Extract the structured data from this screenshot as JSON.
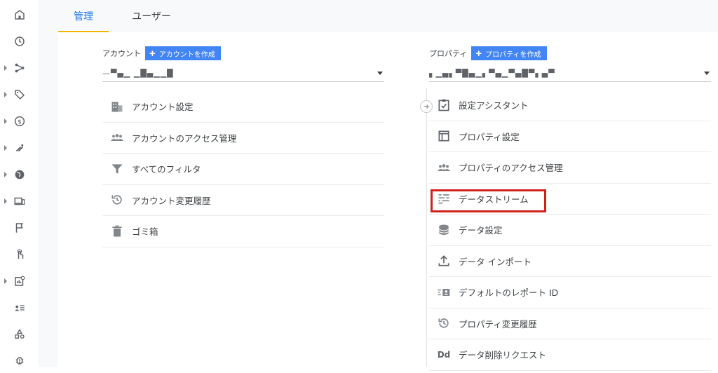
{
  "tabs": [
    {
      "label": "管理"
    },
    {
      "label": "ユーザー"
    }
  ],
  "account": {
    "label": "アカウント",
    "create_button": "アカウントを作成",
    "selected": "—▀▄▁ ▁█▄▁▁█",
    "items": [
      {
        "label": "アカウント設定",
        "icon": "building-icon"
      },
      {
        "label": "アカウントのアクセス管理",
        "icon": "people-icon"
      },
      {
        "label": "すべてのフィルタ",
        "icon": "filter-icon"
      },
      {
        "label": "アカウント変更履歴",
        "icon": "history-icon"
      },
      {
        "label": "ゴミ箱",
        "icon": "trash-icon"
      }
    ]
  },
  "property": {
    "label": "プロパティ",
    "create_button": "プロパティを作成",
    "selected": "▖▁▄▖▀█▄▁▖▀▄▁▀▄█▀▖▄▀",
    "items": [
      {
        "label": "設定アシスタント",
        "icon": "checklist-icon"
      },
      {
        "label": "プロパティ設定",
        "icon": "layout-icon"
      },
      {
        "label": "プロパティのアクセス管理",
        "icon": "people-icon"
      },
      {
        "label": "データストリーム",
        "icon": "streams-icon",
        "highlighted": true
      },
      {
        "label": "データ設定",
        "icon": "database-icon"
      },
      {
        "label": "データ インポート",
        "icon": "upload-icon"
      },
      {
        "label": "デフォルトのレポート ID",
        "icon": "report-id-icon"
      },
      {
        "label": "プロパティ変更履歴",
        "icon": "history-icon"
      },
      {
        "label": "データ削除リクエスト",
        "icon": "data-deletion-icon",
        "icon_text": "Dd"
      }
    ]
  },
  "colors": {
    "accent": "#1a73e8",
    "tab_underline": "#f4b400",
    "button": "#4285f4",
    "highlight": "#d0211b"
  }
}
